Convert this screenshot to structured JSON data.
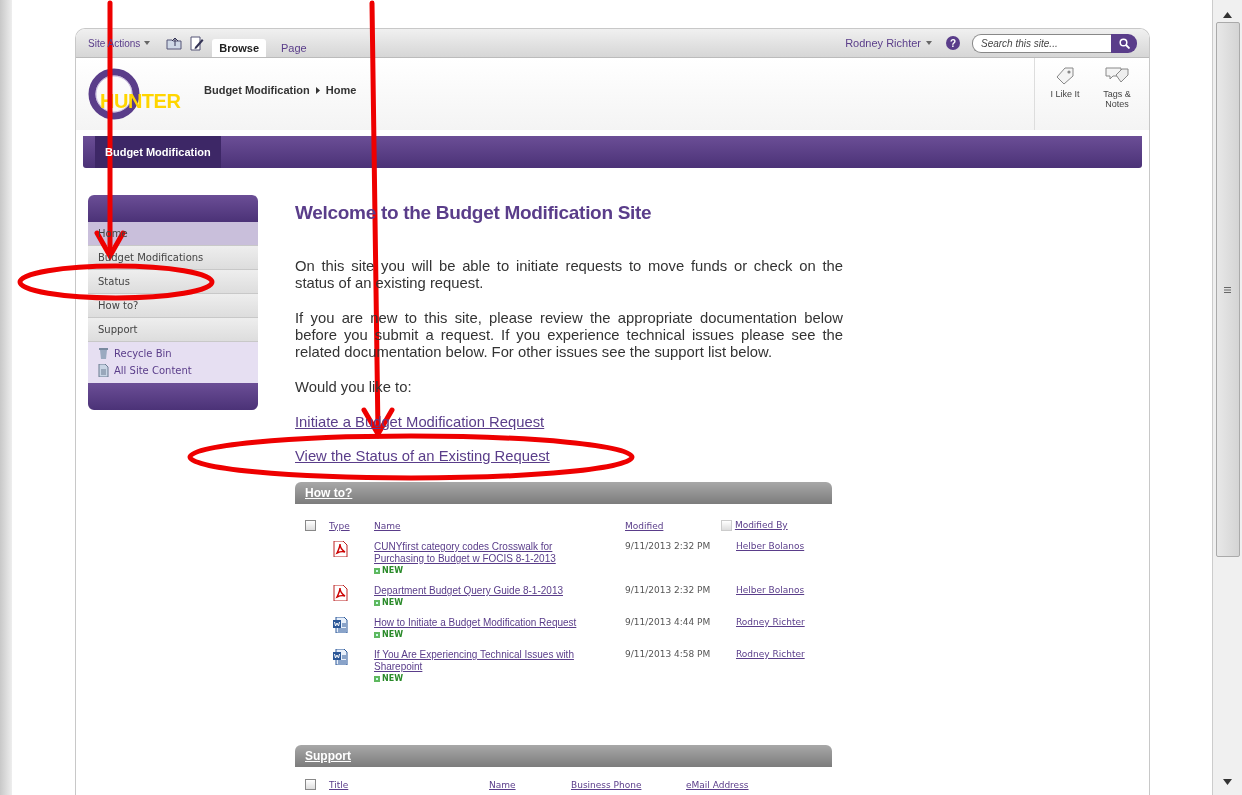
{
  "ribbon": {
    "site_actions": "Site Actions",
    "tabs": [
      {
        "label": "Browse",
        "selected": true
      },
      {
        "label": "Page",
        "selected": false
      }
    ],
    "user": "Rodney Richter",
    "help": "?",
    "search": {
      "placeholder": "Search this site..."
    }
  },
  "header": {
    "logo_text": "HUNTER",
    "breadcrumb": [
      "Budget Modification",
      "Home"
    ],
    "social": [
      {
        "label": "I Like It",
        "kind": "like"
      },
      {
        "label": "Tags & Notes",
        "kind": "tags"
      }
    ]
  },
  "top_nav": [
    {
      "label": "Budget Modification",
      "selected": true
    }
  ],
  "sidebar": {
    "items": [
      {
        "label": "Home",
        "selected": true
      },
      {
        "label": "Budget Modifications",
        "selected": false
      },
      {
        "label": "Status",
        "selected": false
      },
      {
        "label": "How to?",
        "selected": false
      },
      {
        "label": "Support",
        "selected": false
      }
    ],
    "links": [
      {
        "label": "Recycle Bin",
        "kind": "recycle"
      },
      {
        "label": "All Site Content",
        "kind": "content"
      }
    ]
  },
  "content": {
    "title": "Welcome to the Budget Modification Site",
    "paragraphs": [
      "On this site you will be able to initiate requests to move funds or check on the status of an existing request.",
      "If you are new to this site, please review the appropriate documentation below before you submit a request. If you experience technical issues please see the related documentation below. For other issues see the support list below.",
      "Would you like to:"
    ],
    "links": [
      "Initiate a Budget Modification Request",
      "View the Status of an Existing Request"
    ]
  },
  "how_to": {
    "title": "How to?",
    "select_all": {
      "checked": false
    },
    "people_filter": {
      "checked": false
    },
    "columns": [
      "Type",
      "Name",
      "Modified",
      "Modified By"
    ],
    "rows": [
      {
        "kind": "pdf",
        "name": "CUNYfirst category codes Crosswalk for Purchasing to Budget w FOCIS 8-1-2013",
        "new_badge": "NEW",
        "modified": "9/11/2013 2:32 PM",
        "modified_by": "Helber Bolanos"
      },
      {
        "kind": "pdf",
        "name": "Department Budget Query Guide 8-1-2013",
        "new_badge": "NEW",
        "modified": "9/11/2013 2:32 PM",
        "modified_by": "Helber Bolanos"
      },
      {
        "kind": "word",
        "name": "How to Initiate a Budget Modification Request",
        "new_badge": "NEW",
        "modified": "9/11/2013 4:44 PM",
        "modified_by": "Rodney Richter"
      },
      {
        "kind": "word",
        "name": "If You Are Experiencing Technical Issues with Sharepoint",
        "new_badge": "NEW",
        "modified": "9/11/2013 4:58 PM",
        "modified_by": "Rodney Richter"
      }
    ]
  },
  "support": {
    "title": "Support",
    "select_all": {
      "checked": false
    },
    "columns": [
      "Title",
      "Name",
      "Business Phone",
      "eMail Address"
    ]
  }
}
